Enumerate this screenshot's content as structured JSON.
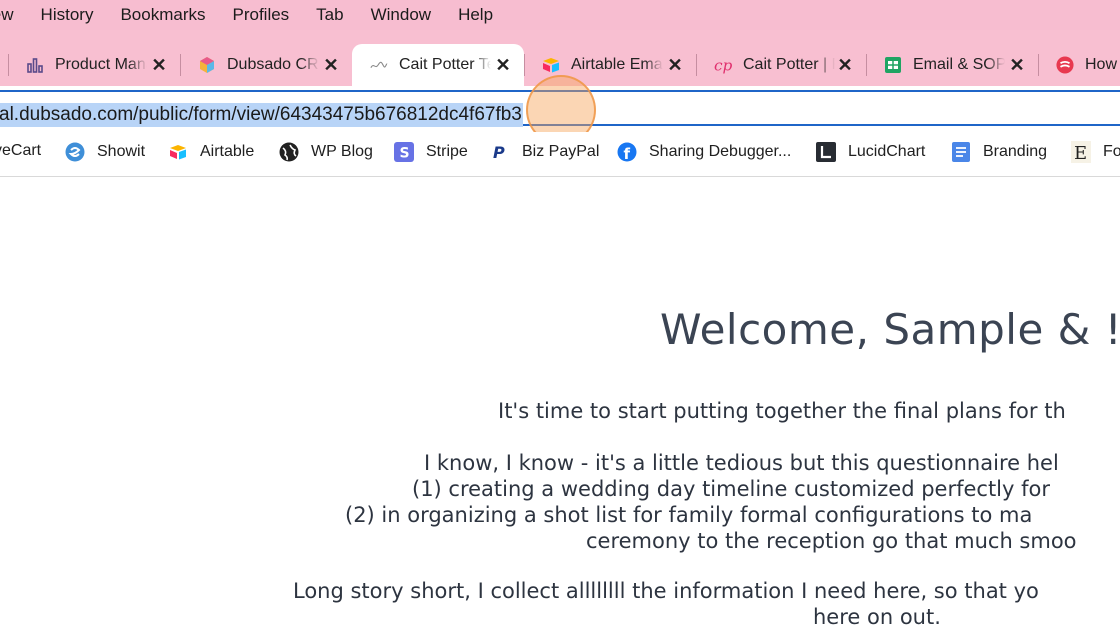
{
  "menubar": {
    "items": [
      "View",
      "History",
      "Bookmarks",
      "Profiles",
      "Tab",
      "Window",
      "Help"
    ]
  },
  "tabs": [
    {
      "title": "Product Manager",
      "icon": "bar-chart-icon",
      "active": false
    },
    {
      "title": "Dubsado CRM",
      "icon": "dubsado-icon",
      "active": false
    },
    {
      "title": "Cait Potter Test",
      "icon": "signature-icon",
      "active": true
    },
    {
      "title": "Airtable Email",
      "icon": "airtable-icon",
      "active": false
    },
    {
      "title": "Cait Potter | Photo",
      "icon": "cp-logo-icon",
      "active": false
    },
    {
      "title": "Email & SOPs",
      "icon": "sheets-icon",
      "active": false
    },
    {
      "title": "How",
      "icon": "red-logo-icon",
      "active": false
    }
  ],
  "address": {
    "url": "al.dubsado.com/public/form/view/64343475b676812dc4f67fb3"
  },
  "bookmarks": [
    {
      "label": "veCart",
      "icon": "none"
    },
    {
      "label": "Showit",
      "icon": "showit-icon"
    },
    {
      "label": "Airtable",
      "icon": "airtable-icon"
    },
    {
      "label": "WP Blog",
      "icon": "globe-icon"
    },
    {
      "label": "Stripe",
      "icon": "stripe-icon"
    },
    {
      "label": "Biz PayPal",
      "icon": "paypal-icon"
    },
    {
      "label": "Sharing Debugger...",
      "icon": "facebook-icon"
    },
    {
      "label": "LucidChart",
      "icon": "lucidchart-icon"
    },
    {
      "label": "Branding",
      "icon": "docs-icon"
    },
    {
      "label": "Fo",
      "icon": "e-icon"
    }
  ],
  "page": {
    "welcome": "Welcome, Sample & !",
    "p1": "It's time to start putting together the final plans for th",
    "p2a": "I know, I know - it's a little tedious but this questionnaire hel",
    "p2b": "(1) creating a wedding day timeline customized perfectly for",
    "p2c": "(2) in organizing a shot list for family formal configurations to ma",
    "p2d": "ceremony to the reception go that much smoo",
    "p3a": "Long story short, I collect allllllll the information I need here, so that yo",
    "p3b": "here on out."
  },
  "colors": {
    "menubar_bg": "#f7bdd0",
    "tabstrip_bg": "#f8bfd1",
    "url_highlight": "#b8d4f7",
    "focus_border": "#1f65c8",
    "heading": "#3b4453"
  }
}
